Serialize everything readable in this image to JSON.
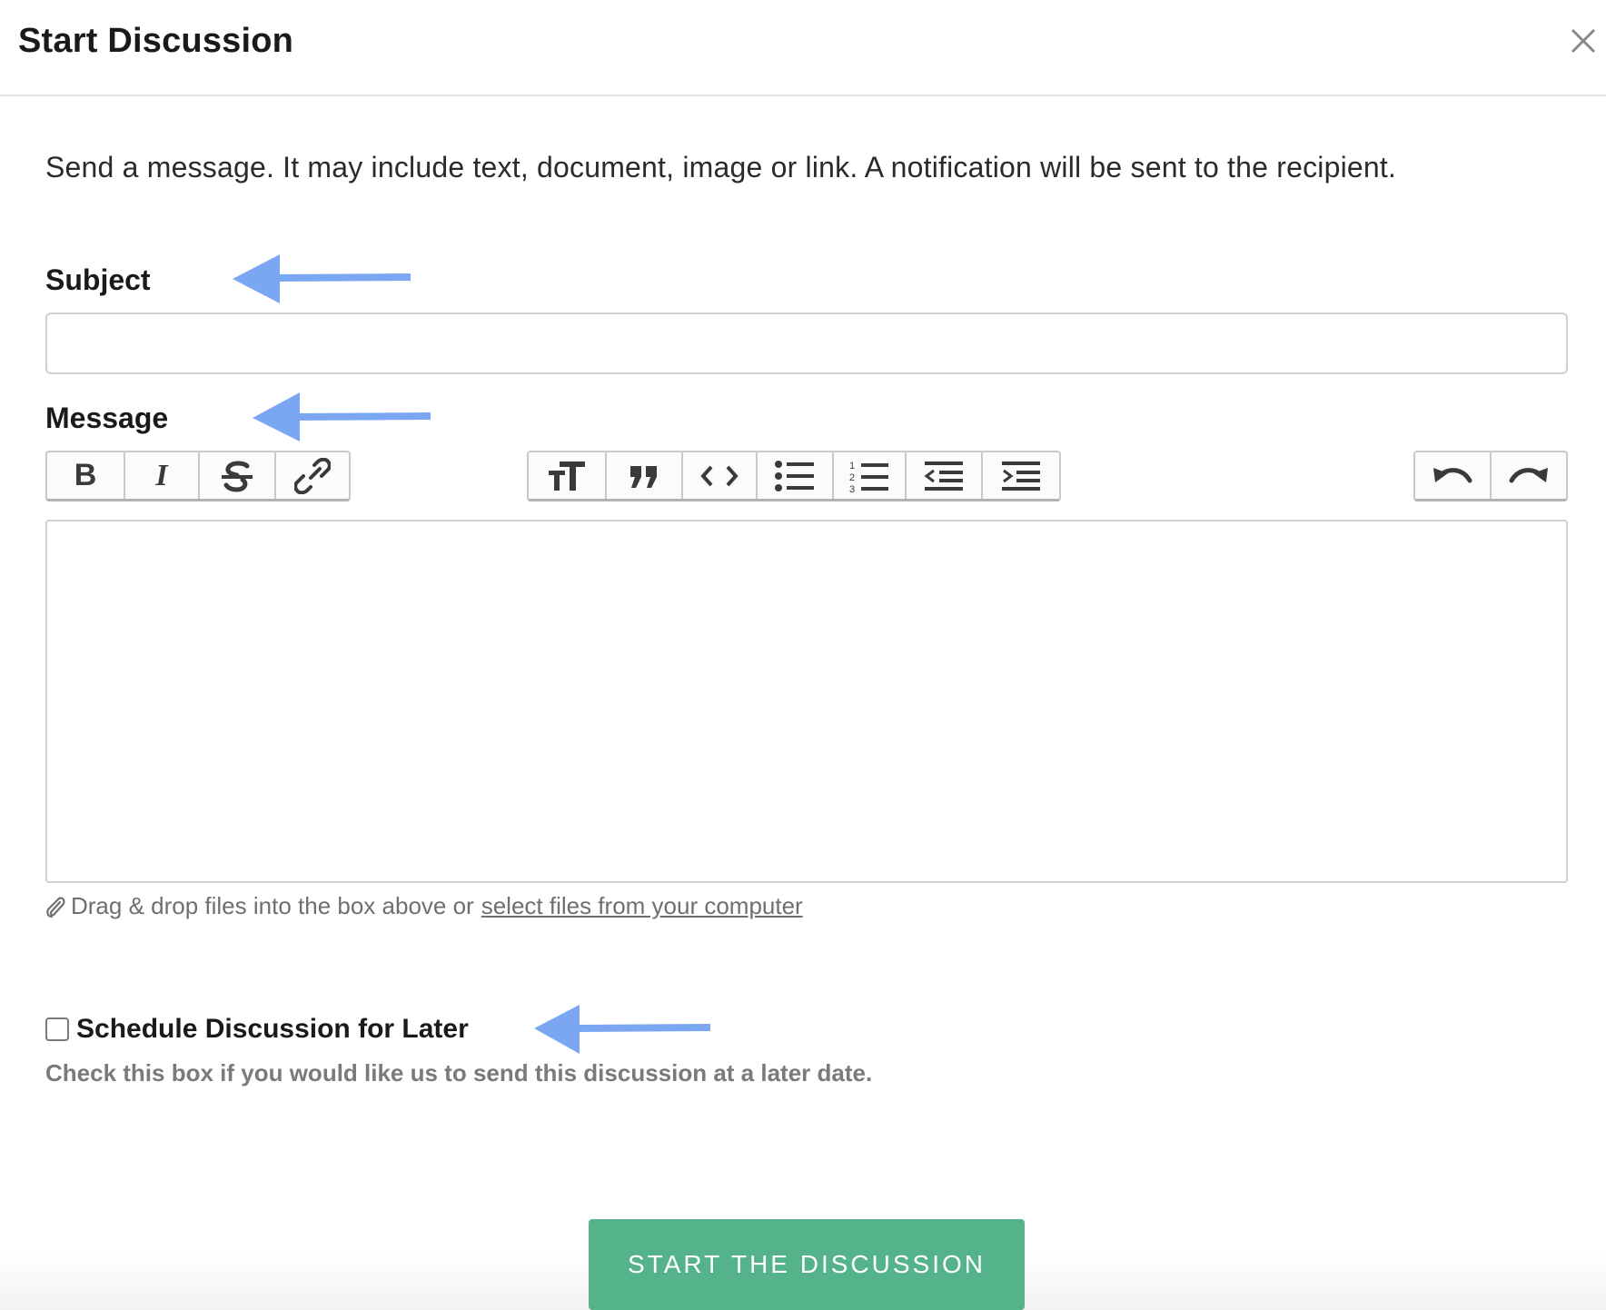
{
  "dialog": {
    "title": "Start Discussion",
    "close_icon": "close-icon"
  },
  "intro_text": "Send a message. It may include text, document, image or link. A notification will be sent to the recipient.",
  "subject": {
    "label": "Subject",
    "value": "",
    "placeholder": ""
  },
  "message": {
    "label": "Message",
    "value": "",
    "toolbar": {
      "bold_label": "B",
      "italic_label": "I",
      "strike_icon": "strikethrough-icon",
      "link_icon": "link-icon",
      "heading_icon": "text-size-icon",
      "quote_icon": "quote-icon",
      "code_icon": "code-icon",
      "bullet_list_icon": "bullet-list-icon",
      "numbered_list_icon": "numbered-list-icon",
      "outdent_icon": "outdent-icon",
      "indent_icon": "indent-icon",
      "undo_icon": "undo-icon",
      "redo_icon": "redo-icon"
    }
  },
  "attachments": {
    "note": "Drag & drop files into the box above or",
    "link_text": "select files from your computer",
    "icon": "paperclip-icon"
  },
  "schedule": {
    "checked": false,
    "label": "Schedule Discussion for Later",
    "help": "Check this box if you would like us to send this discussion at a later date."
  },
  "submit_label": "START THE DISCUSSION",
  "colors": {
    "submit_bg": "#55b38b",
    "annotation_arrow": "#7ba7f2"
  }
}
